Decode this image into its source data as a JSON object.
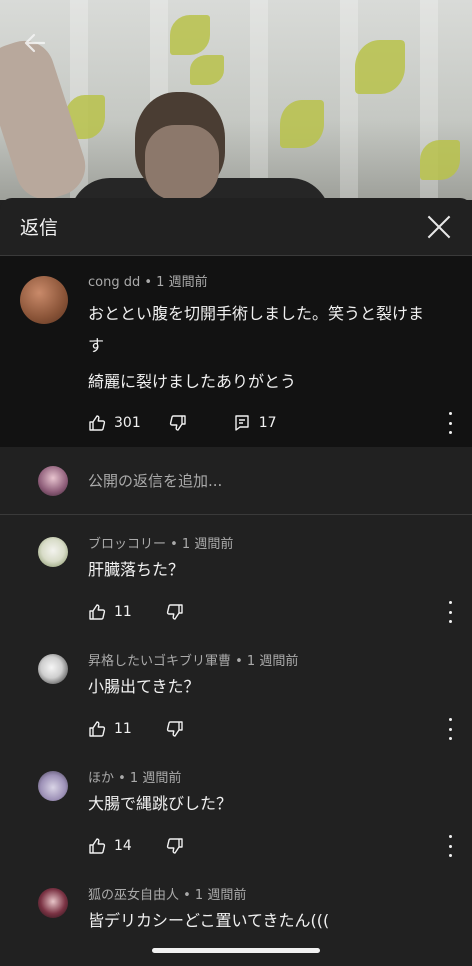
{
  "video": {
    "back_icon": "arrow-left-icon"
  },
  "panel": {
    "title": "返信",
    "close_icon": "close-icon"
  },
  "parent_comment": {
    "author_meta": "cong dd • 1 週間前",
    "text_line1": "おととい腹を切開手術しました。笑うと裂けま",
    "text_line2": "す",
    "text_line3": "綺麗に裂けましたありがとう",
    "likes": "301",
    "replies": "17"
  },
  "add_reply": {
    "placeholder": "公開の返信を追加..."
  },
  "replies": [
    {
      "meta": "ブロッコリー • 1 週間前",
      "text": "肝臓落ちた？",
      "likes": "11"
    },
    {
      "meta": "昇格したいゴキブリ軍曹 • 1 週間前",
      "text": "小腸出てきた？",
      "likes": "11"
    },
    {
      "meta": "ほか • 1 週間前",
      "text": "大腸で縄跳びした？",
      "likes": "14"
    },
    {
      "meta": "狐の巫女自由人 • 1 週間前",
      "text": "皆デリカシーどこ置いてきたん((("
    }
  ],
  "colors": {
    "panel_bg": "#212121",
    "parent_bg": "#121212",
    "text": "#f1f1f1",
    "secondary": "#aaaaaa"
  }
}
